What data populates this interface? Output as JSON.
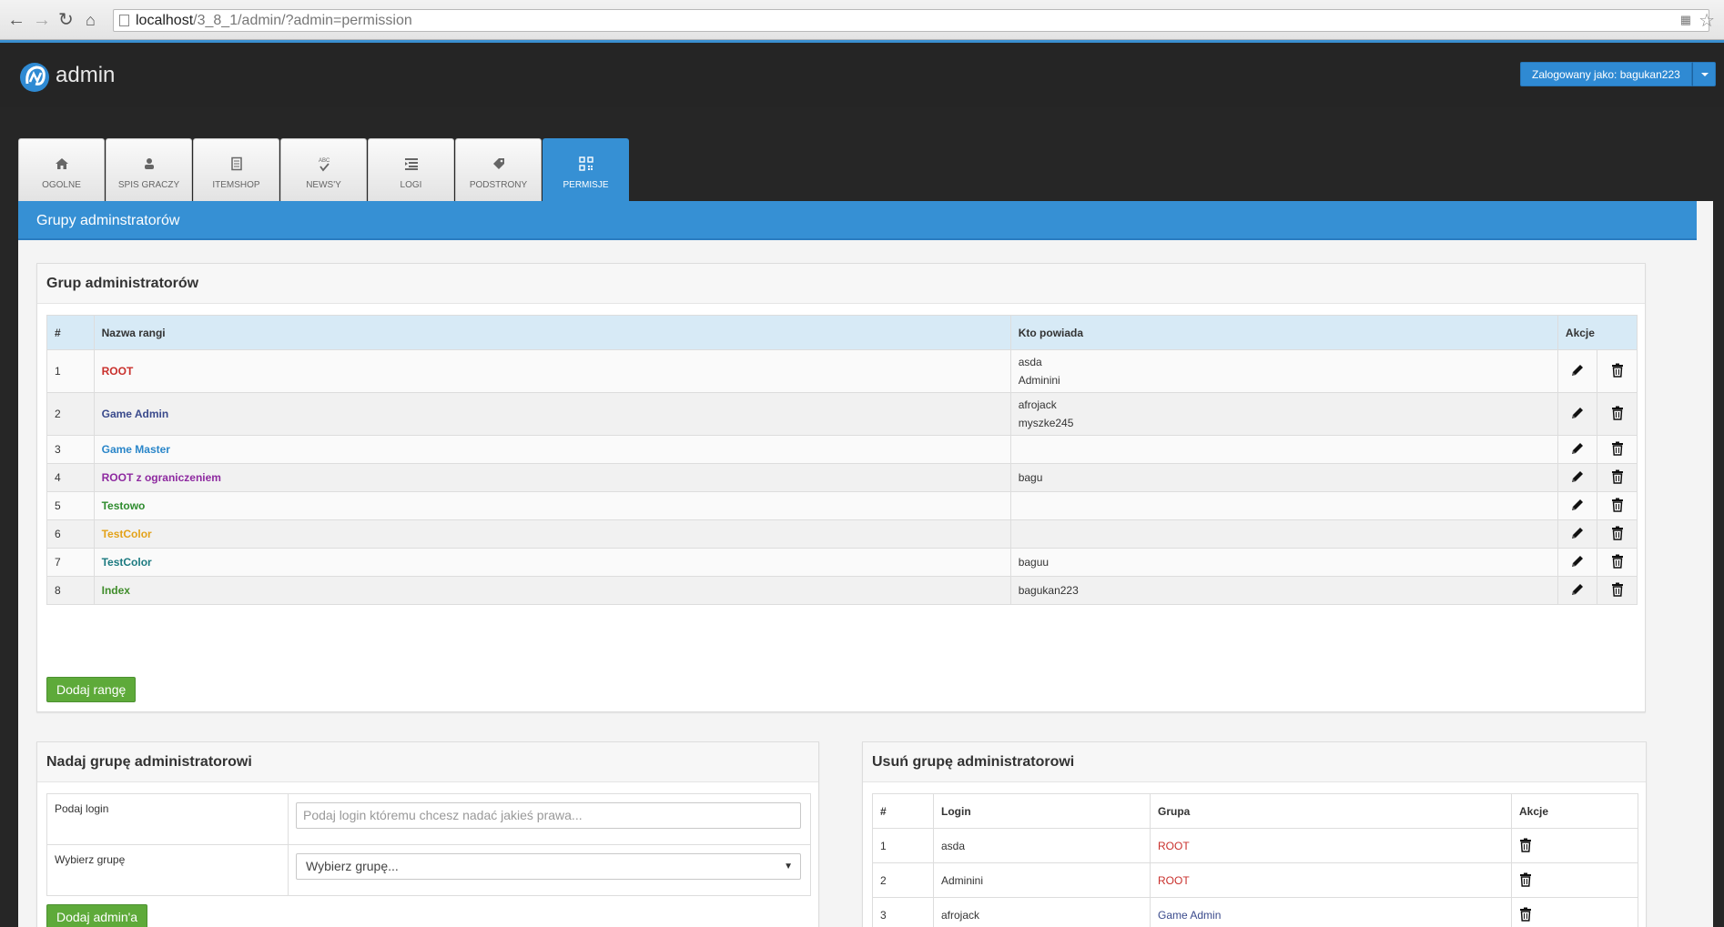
{
  "browser": {
    "url_host": "localhost",
    "url_path": "/3_8_1/admin/?admin=permission"
  },
  "header": {
    "logo_text": "admin",
    "user_label": "Zalogowany jako: bagukan223"
  },
  "tabs": [
    {
      "label": "OGOLNE",
      "icon": "home-icon"
    },
    {
      "label": "SPIS GRACZY",
      "icon": "users-icon"
    },
    {
      "label": "ITEMSHOP",
      "icon": "document-icon"
    },
    {
      "label": "NEWS'Y",
      "icon": "spellcheck-icon"
    },
    {
      "label": "LOGI",
      "icon": "list-icon"
    },
    {
      "label": "PODSTRONY",
      "icon": "tag-icon"
    },
    {
      "label": "PERMISJE",
      "icon": "qrcode-icon",
      "active": true
    }
  ],
  "main": {
    "title": "Grupy adminstratorów"
  },
  "groups": {
    "title": "Grup administratorów",
    "headers": {
      "num": "#",
      "name": "Nazwa rangi",
      "who": "Kto powiada",
      "actions": "Akcje"
    },
    "rows": [
      {
        "num": "1",
        "name": "ROOT",
        "color": "#c9302c",
        "who": [
          "asda",
          "Adminini"
        ]
      },
      {
        "num": "2",
        "name": "Game Admin",
        "color": "#3a4a8c",
        "who": [
          "afrojack",
          "myszke245"
        ]
      },
      {
        "num": "3",
        "name": "Game Master",
        "color": "#2a86c9",
        "who": []
      },
      {
        "num": "4",
        "name": "ROOT z ograniczeniem",
        "color": "#8e2aa0",
        "who": [
          "bagu"
        ]
      },
      {
        "num": "5",
        "name": "Testowo",
        "color": "#2f8c2f",
        "who": []
      },
      {
        "num": "6",
        "name": "TestColor",
        "color": "#e3a21a",
        "who": []
      },
      {
        "num": "7",
        "name": "TestColor",
        "color": "#1c7a80",
        "who": [
          "baguu"
        ]
      },
      {
        "num": "8",
        "name": "Index",
        "color": "#3f8c2a",
        "who": [
          "bagukan223"
        ]
      }
    ],
    "add_button": "Dodaj rangę"
  },
  "assign": {
    "title": "Nadaj grupę administratorowi",
    "login_label": "Podaj login",
    "login_placeholder": "Podaj login któremu chcesz nadać jakieś prawa...",
    "group_label": "Wybierz grupę",
    "group_selected": "Wybierz grupę...",
    "submit": "Dodaj admin'a"
  },
  "remove": {
    "title": "Usuń grupę administratorowi",
    "headers": {
      "num": "#",
      "login": "Login",
      "group": "Grupa",
      "actions": "Akcje"
    },
    "rows": [
      {
        "num": "1",
        "login": "asda",
        "group": "ROOT",
        "color": "#c9302c"
      },
      {
        "num": "2",
        "login": "Adminini",
        "group": "ROOT",
        "color": "#c9302c"
      },
      {
        "num": "3",
        "login": "afrojack",
        "group": "Game Admin",
        "color": "#3a4a8c"
      }
    ]
  }
}
